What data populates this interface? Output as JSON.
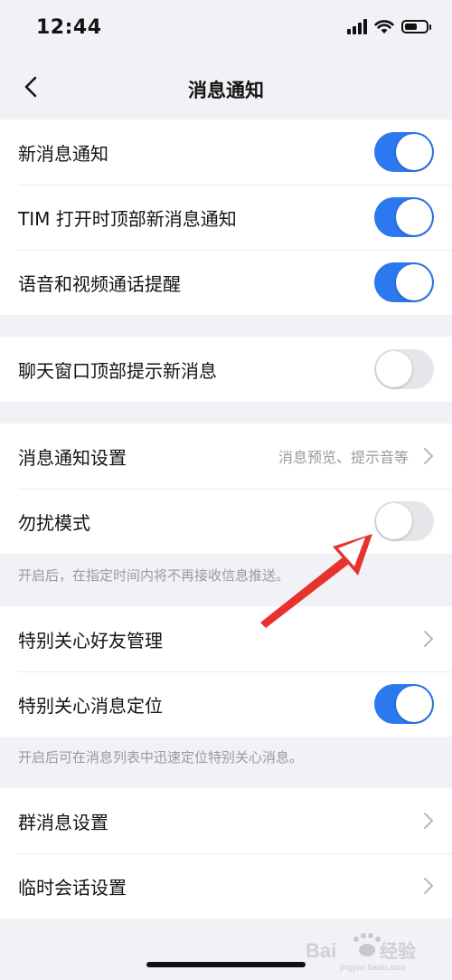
{
  "status_bar": {
    "time": "12:44"
  },
  "nav": {
    "title": "消息通知"
  },
  "group1": [
    {
      "label": "新消息通知",
      "toggle": true
    },
    {
      "label": "TIM 打开时顶部新消息通知",
      "toggle": true
    },
    {
      "label": "语音和视频通话提醒",
      "toggle": true
    }
  ],
  "group2": [
    {
      "label": "聊天窗口顶部提示新消息",
      "toggle": false
    }
  ],
  "group3": {
    "settings": {
      "label": "消息通知设置",
      "value": "消息预览、提示音等"
    },
    "dnd": {
      "label": "勿扰模式",
      "toggle": false
    },
    "hint": "开启后，在指定时间内将不再接收信息推送。"
  },
  "group4": {
    "manage": {
      "label": "特别关心好友管理"
    },
    "locate": {
      "label": "特别关心消息定位",
      "toggle": true
    },
    "hint": "开启后可在消息列表中迅速定位特别关心消息。"
  },
  "group5": [
    {
      "label": "群消息设置"
    },
    {
      "label": "临时会话设置"
    }
  ],
  "colors": {
    "accent": "#2c78ee",
    "background": "#f1f2f6",
    "annotation_arrow": "#e8322f"
  }
}
